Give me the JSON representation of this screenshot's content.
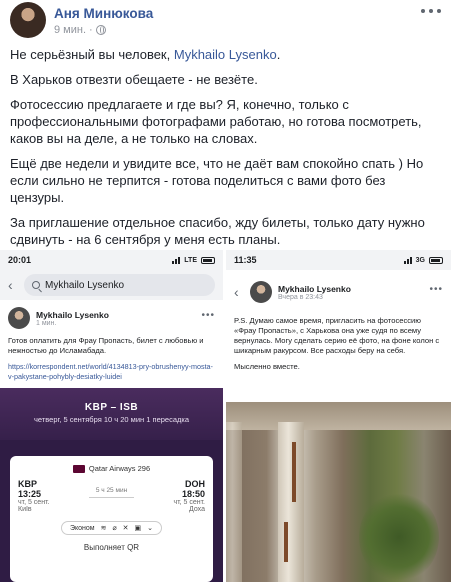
{
  "post": {
    "author": "Аня Минюкова",
    "time": "9 мин.",
    "privacy_icon": "globe-icon",
    "more_icon": "more-horizontal-icon",
    "colors": {
      "link": "#385898",
      "meta": "#90949c",
      "text": "#1d2129"
    }
  },
  "text": {
    "p1_before": "Не серьёзный вы человек, ",
    "p1_mention": "Mykhailo Lysenko",
    "p1_after": ".",
    "p2": "В Харьков отвезти обещаете - не везёте.",
    "p3": "Фотосессию предлагаете и где вы? Я, конечно, только с профессиональными фотографами работаю, но готова посмотреть, каков вы на деле, а не только на словах.",
    "p4": "Ещё две недели и увидите все, что не даёт вам спокойно спать ) Но если сильно не терпится - готова поделиться с вами фото без цензуры.",
    "p5": "За приглашение отдельное спасибо, жду билеты, только дату нужно сдвинуть - на 6 сентября у меня есть планы."
  },
  "screenshot_left": {
    "status_time": "20:01",
    "status_net": "LTE",
    "search_text": "Mykhailo Lysenko",
    "name": "Mykhailo Lysenko",
    "time": "1 мин.",
    "post_text": "Готов оплатить для Фрау Пропасть, билет с любовью и нежностью до Исламабада.",
    "link": "https://korrespondent.net/world/4134813-pry-obrushenyy-mosta-v-pakystane-pohybly-desiatky-luidei",
    "route": "KBP – ISB",
    "route_info": "четверг, 5 сентября  10 ч 20 мин  1 пересадка",
    "airline": "Qatar Airways 296",
    "from_code": "KBP",
    "from_time": "13:25",
    "from_date": "чт, 5 сент.",
    "from_city": "Київ",
    "to_code": "DOH",
    "to_time": "18:50",
    "to_date": "чт, 5 сент.",
    "to_city": "Доха",
    "duration": "5 ч 25 мин",
    "class": "Эконом",
    "footer": "Выполняет QR"
  },
  "screenshot_right": {
    "status_time": "11:35",
    "status_net": "3G",
    "name": "Mykhailo Lysenko",
    "time": "Вчера в 23:43",
    "post_text": "P.S. Думаю самое время, пригласить на фотосессию «Фрау Пропасть», с Харькова она уже судя по всему вернулась. Могу сделать серию её фото, на фоне колон с шикарным ракурсом. Все расходы беру на себя.",
    "post_text2": "Мысленно вместе."
  }
}
